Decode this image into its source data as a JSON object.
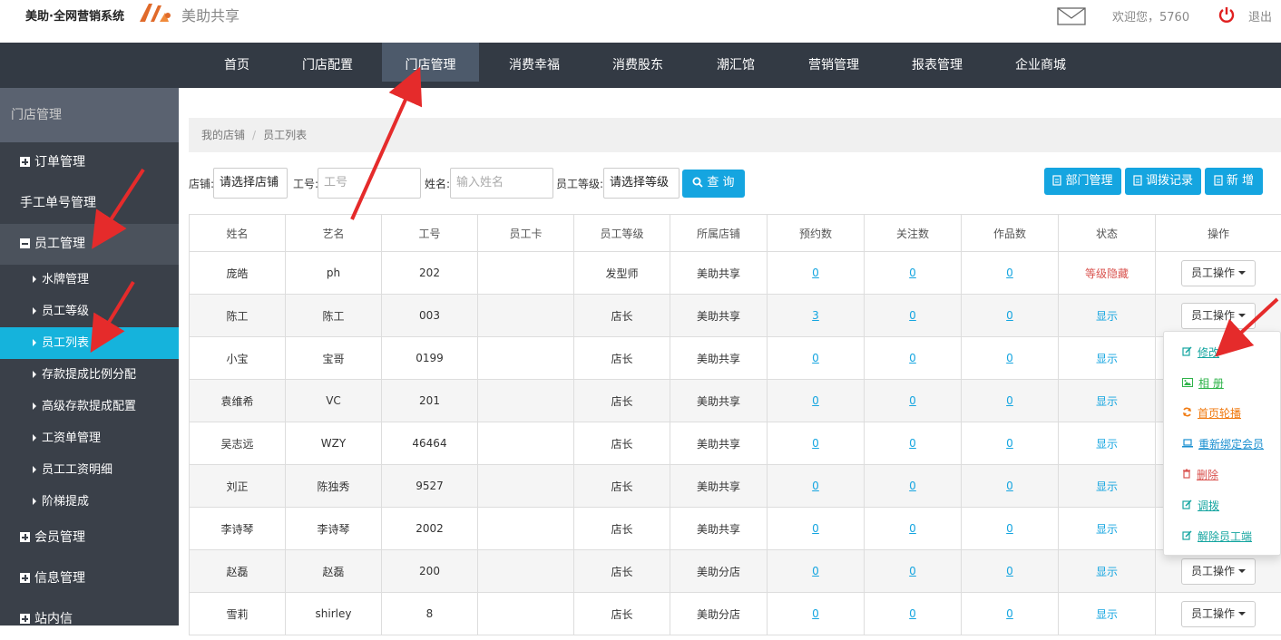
{
  "header": {
    "brand": "美助·全网营销系统",
    "brand_sub": "美助共享",
    "welcome": "欢迎您，5760",
    "logout": "退出"
  },
  "nav": [
    "首页",
    "门店配置",
    "门店管理",
    "消费幸福",
    "消费股东",
    "潮汇馆",
    "营销管理",
    "报表管理",
    "企业商城"
  ],
  "sidebar": {
    "title": "门店管理",
    "items": [
      "订单管理",
      "手工单号管理",
      "员工管理"
    ],
    "subitems": [
      "水牌管理",
      "员工等级",
      "员工列表",
      "存款提成比例分配",
      "高级存款提成配置",
      "工资单管理",
      "员工工资明细",
      "阶梯提成"
    ],
    "bottom": [
      "会员管理",
      "信息管理",
      "站内信"
    ]
  },
  "breadcrumb": [
    "我的店铺",
    "员工列表"
  ],
  "filters": {
    "store_label": "店铺:",
    "store_value": "请选择店铺",
    "id_label": "工号:",
    "id_placeholder": "工号",
    "name_label": "姓名:",
    "name_placeholder": "输入姓名",
    "level_label": "员工等级:",
    "level_value": "请选择等级",
    "search": "查 询"
  },
  "actions": [
    "部门管理",
    "调拨记录",
    "新 增"
  ],
  "table": {
    "headers": [
      "姓名",
      "艺名",
      "工号",
      "员工卡",
      "员工等级",
      "所属店铺",
      "预约数",
      "关注数",
      "作品数",
      "状态",
      "操作"
    ],
    "rows": [
      [
        "庞皓",
        "ph",
        "202",
        "",
        "发型师",
        "美助共享",
        "0",
        "0",
        "0",
        "等级隐藏"
      ],
      [
        "陈工",
        "陈工",
        "003",
        "",
        "店长",
        "美助共享",
        "3",
        "0",
        "0",
        "显示"
      ],
      [
        "小宝",
        "宝哥",
        "0199",
        "",
        "店长",
        "美助共享",
        "0",
        "0",
        "0",
        "显示"
      ],
      [
        "袁维希",
        "VC",
        "201",
        "",
        "店长",
        "美助共享",
        "0",
        "0",
        "0",
        "显示"
      ],
      [
        "吴志远",
        "WZY",
        "46464",
        "",
        "店长",
        "美助共享",
        "0",
        "0",
        "0",
        "显示"
      ],
      [
        "刘正",
        "陈独秀",
        "9527",
        "",
        "店长",
        "美助共享",
        "0",
        "0",
        "0",
        "显示"
      ],
      [
        "李诗琴",
        "李诗琴",
        "2002",
        "",
        "店长",
        "美助共享",
        "0",
        "0",
        "0",
        "显示"
      ],
      [
        "赵磊",
        "赵磊",
        "200",
        "",
        "店长",
        "美助分店",
        "0",
        "0",
        "0",
        "显示"
      ],
      [
        "雪莉",
        "shirley",
        "8",
        "",
        "店长",
        "美助分店",
        "0",
        "0",
        "0",
        "显示"
      ]
    ],
    "op_label": "员工操作"
  },
  "dropdown": [
    {
      "label": "修改",
      "icon": "edit-icon",
      "color": "#15a5a0"
    },
    {
      "label": "相 册",
      "icon": "image-icon",
      "color": "#2fb34a"
    },
    {
      "label": "首页轮播",
      "icon": "refresh-icon",
      "color": "#f07a10"
    },
    {
      "label": "重新绑定会员",
      "icon": "laptop-icon",
      "color": "#1a8fd0"
    },
    {
      "label": "删除",
      "icon": "trash-icon",
      "color": "#d9534f"
    },
    {
      "label": "调拨",
      "icon": "edit-icon",
      "color": "#15a5a0"
    },
    {
      "label": "解除员工端",
      "icon": "edit-icon",
      "color": "#15a5a0"
    }
  ]
}
